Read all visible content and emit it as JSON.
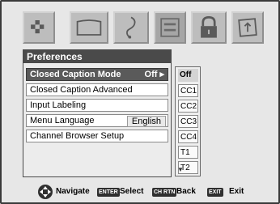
{
  "panel": {
    "title": "Preferences",
    "rows": [
      {
        "label": "Closed Caption Mode",
        "value": "Off ▸",
        "selected": true
      },
      {
        "label": "Closed Caption Advanced",
        "value": ""
      },
      {
        "label": "Input Labeling",
        "value": ""
      },
      {
        "label": "Menu Language",
        "value": "English"
      },
      {
        "label": "Channel Browser Setup",
        "value": ""
      }
    ]
  },
  "options": {
    "items": [
      "Off",
      "CC1",
      "CC2",
      "CC3",
      "CC4",
      "T1",
      "T2"
    ],
    "selected": "Off",
    "scroll_indicator": "▼"
  },
  "legend": {
    "navigate_label": "Navigate",
    "enter_key": "ENTER",
    "select_label": "Select",
    "back_key": "CH RTN",
    "back_label": "Back",
    "exit_key": "EXIT",
    "exit_label": "Exit"
  },
  "icons": [
    "picture-icon",
    "screen-icon",
    "audio-icon",
    "preferences-icon",
    "lock-icon",
    "setup-icon"
  ],
  "colors": {
    "background": "#e7e7e7",
    "title_bar": "#4a4a4a",
    "selected_row": "#5a5a5a"
  }
}
